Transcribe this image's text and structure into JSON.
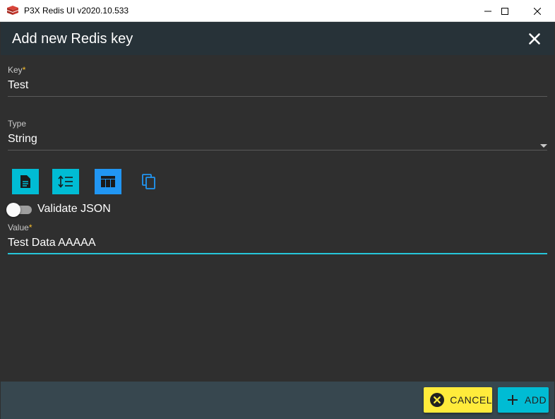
{
  "window": {
    "title": "P3X Redis UI v2020.10.533",
    "app_icon": "redis-logo-icon"
  },
  "dialog": {
    "title": "Add new Redis key",
    "close_icon": "close-icon"
  },
  "form": {
    "key": {
      "label": "Key",
      "required_mark": "*",
      "value": "Test"
    },
    "type": {
      "label": "Type",
      "value": "String"
    },
    "toolbar": [
      {
        "icon": "document-icon",
        "color": "#00bcd4"
      },
      {
        "icon": "line-height-icon",
        "color": "#00bcd4"
      },
      {
        "icon": "table-icon",
        "color": "#2196f3"
      },
      {
        "icon": "copy-icon",
        "color": "#2196f3"
      }
    ],
    "validate_json": {
      "label": "Validate JSON",
      "checked": false
    },
    "value": {
      "label": "Value",
      "required_mark": "*",
      "value": "Test Data AAAAA"
    }
  },
  "footer": {
    "cancel_label": "CANCEL",
    "add_label": "ADD"
  },
  "colors": {
    "header": "#273238",
    "content": "#2f2f2f",
    "footer": "#37474f",
    "accent_cyan": "#00bcd4",
    "accent_blue": "#2196f3",
    "cancel_yellow": "#ffeb3b",
    "required": "#fbc02d"
  }
}
